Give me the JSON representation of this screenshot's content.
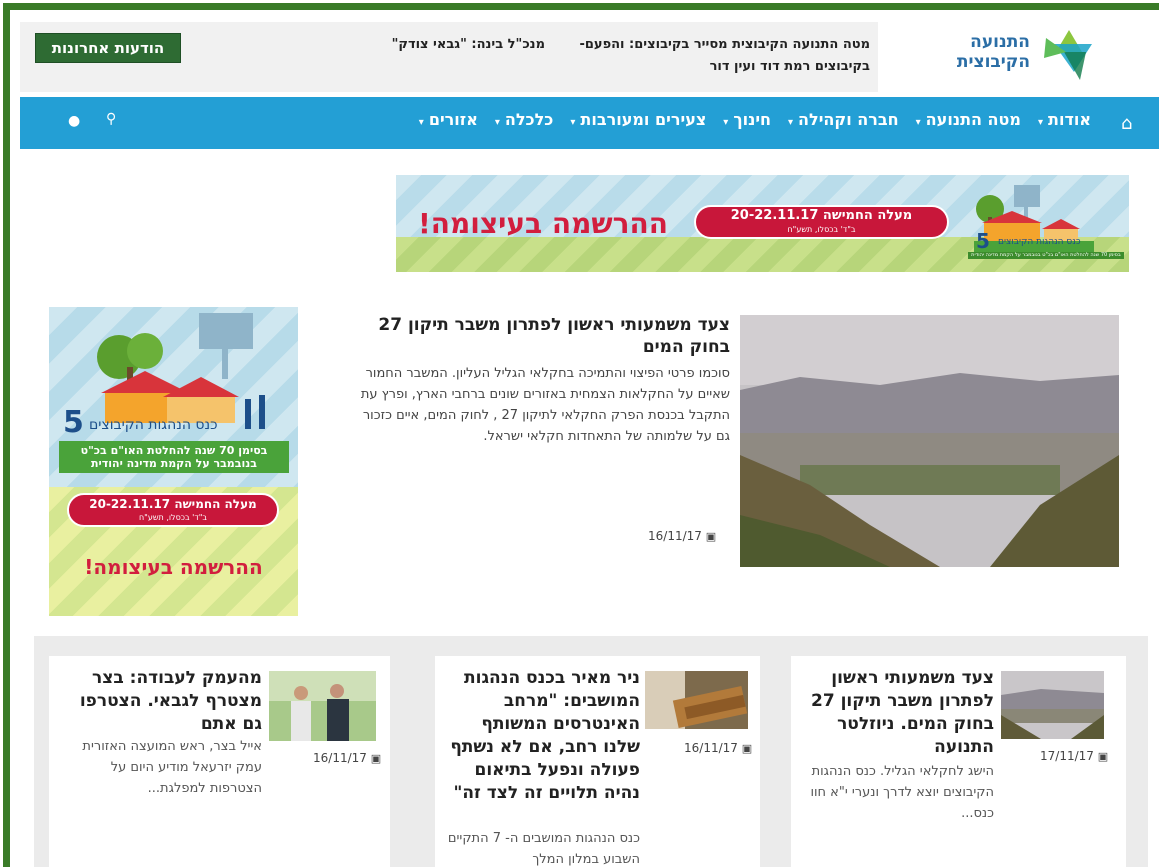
{
  "header": {
    "latest_button": "הודעות אחרונות",
    "ticker_main": "מטה התנועה הקיבוצית מסייר בקיבוצים: והפעם- בקיבוצים רמת דוד ועין דור",
    "ticker_secondary": "מנכ\"ל בינה: \"גבאי צודק\"",
    "logo_text": "התנועה הקיבוצית"
  },
  "nav": {
    "items": [
      {
        "label": "אודות"
      },
      {
        "label": "מטה התנועה"
      },
      {
        "label": "חברה וקהילה"
      },
      {
        "label": "חינוך"
      },
      {
        "label": "צעירים ומעורבות"
      },
      {
        "label": "כלכלה"
      },
      {
        "label": "אזורים"
      }
    ],
    "home_icon": "home-icon",
    "search_icon": "search-icon",
    "user_icon": "user-icon"
  },
  "banner": {
    "cta": "ההרשמה בעיצומה!",
    "pill_line1": "מעלה החמישה 20-22.11.17",
    "pill_line2": "ב\"ד' בכסלו, תשע\"ח",
    "conf_title": "כנס הנהגות הקיבוצים",
    "conf_number": "5",
    "conf_sub": "בסימן 70 שנה להחלטת האו\"ם בכ\"ט בנובמבר על הקמת מדינה יהודית"
  },
  "side_ad": {
    "number": "5",
    "title": "כנס הנהגות הקיבוצים",
    "subtitle": "בסימן 70 שנה להחלטת האו\"ם בכ\"ט בנובמבר על הקמת מדינה יהודית",
    "pill_line1": "מעלה החמישה 20-22.11.17",
    "pill_line2": "ב\"ד' בכסלו, תשע\"ח",
    "cta": "ההרשמה בעיצומה!"
  },
  "feature": {
    "title": "צעד משמעותי ראשון לפתרון משבר תיקון 27 בחוק המים",
    "text": "סוכמו פרטי הפיצוי והתמיכה בחקלאי הגליל העליון. המשבר החמור שאיים על החקלאות הצמחית באזורים שונים ברחבי הארץ, ופרץ עת התקבל בכנסת הפרק החקלאי לתיקון 27 , לחוק המים, איים כזכור גם על שלמותה של התאחדות חקלאי ישראל.",
    "date": "16/11/17"
  },
  "cards": [
    {
      "title": "צעד משמעותי ראשון לפתרון משבר תיקון 27 בחוק המים. ניוזלטר התנועה",
      "text": "הישג לחקלאי הגליל. כנס הנהגות הקיבוצים יוצא לדרך ונערי י\"א חוו כנס...",
      "date": "17/11/17"
    },
    {
      "title": "ניר מאיר בכנס הנהגות המושבים: \"מרחב האינטרסים המשותף שלנו רחב, אם לא נשתף פעולה ונפעל בתיאום נהיה תלויים זה לצד זה\"",
      "text": "כנס הנהגות המושבים ה- 7 התקיים השבוע במלון המלך",
      "date": "16/11/17"
    },
    {
      "title": "מהעמק לעבודה: בצר מצטרף לגבאי. הצטרפו גם אתם",
      "text": "אייל בצר, ראש המועצה האזורית עמק יזרעאל מודיע היום על הצטרפות למפלגת...",
      "date": "16/11/17"
    }
  ],
  "colors": {
    "frame_green": "#3a7b28",
    "nav_blue": "#239fd5",
    "latest_button": "#2e6b33",
    "cta_red": "#d21e3e"
  }
}
